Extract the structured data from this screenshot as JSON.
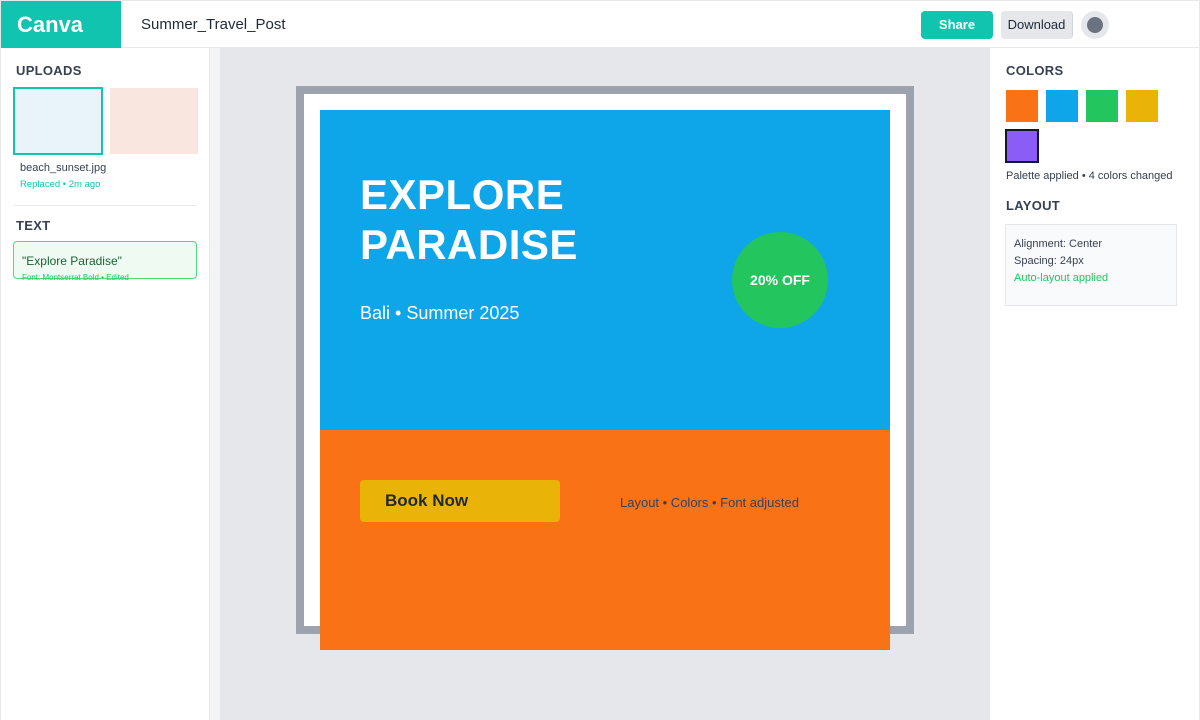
{
  "app": {
    "logo": "Canva",
    "document_title": "Summer_Travel_Post",
    "share_label": "Share",
    "download_label": "Download"
  },
  "left_panel": {
    "uploads": {
      "heading": "UPLOADS",
      "file_name": "beach_sunset.jpg",
      "file_status": "Replaced • 2m ago"
    },
    "text": {
      "heading": "TEXT",
      "item_label": "\"Explore Paradise\"",
      "item_meta": "Font: Montserrat Bold • Edited"
    }
  },
  "canvas": {
    "headline_line1": "EXPLORE",
    "headline_line2": "PARADISE",
    "subline": "Bali • Summer 2025",
    "badge": "20% OFF",
    "cta": "Book Now",
    "note": "Layout • Colors • Font adjusted"
  },
  "right_panel": {
    "colors_heading": "COLORS",
    "swatches": [
      "#f97316",
      "#0ea5e9",
      "#22c55e",
      "#eab308",
      "#8b5cf6"
    ],
    "selected_swatch_index": 4,
    "palette_note": "Palette applied • 4 colors changed",
    "layout_heading": "LAYOUT",
    "alignment": "Alignment: Center",
    "spacing": "Spacing: 24px",
    "auto_layout": "Auto-layout applied"
  },
  "theme": {
    "brand": "#10c4b0",
    "design_top": "#0ea5e9",
    "design_bottom": "#f97316",
    "badge": "#22c55e",
    "cta": "#eab308"
  }
}
